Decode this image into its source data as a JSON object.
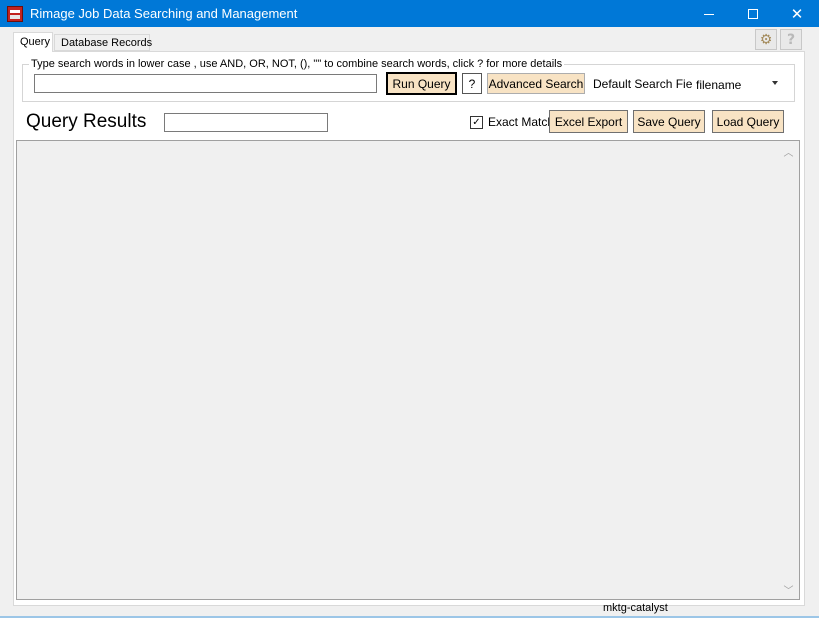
{
  "window": {
    "title": "Rimage Job Data Searching and Management",
    "icon": "rimage-app-icon",
    "accent_color": "#0078d7"
  },
  "tabs": [
    {
      "label": "Query",
      "selected": true
    },
    {
      "label": "Database Records",
      "selected": false
    }
  ],
  "toolbar_icons": [
    "gear-icon",
    "help-icon"
  ],
  "search": {
    "instructions": "Type search words in lower case , use AND, OR, NOT, (), \"\" to combine search words, click ? for more details",
    "input_value": "",
    "run_label": "Run Query",
    "help_label": "?",
    "advanced_label": "Advanced Search",
    "default_field_label": "Default Search Field:",
    "default_field_value": "filename"
  },
  "results": {
    "title": "Query Results",
    "filter_value": "",
    "exact_match_label": "Exact Match",
    "exact_match_checked": true,
    "excel_export_label": "Excel Export",
    "save_query_label": "Save Query",
    "load_query_label": "Load Query",
    "rows": []
  },
  "status": {
    "text": "mktg-catalyst"
  }
}
